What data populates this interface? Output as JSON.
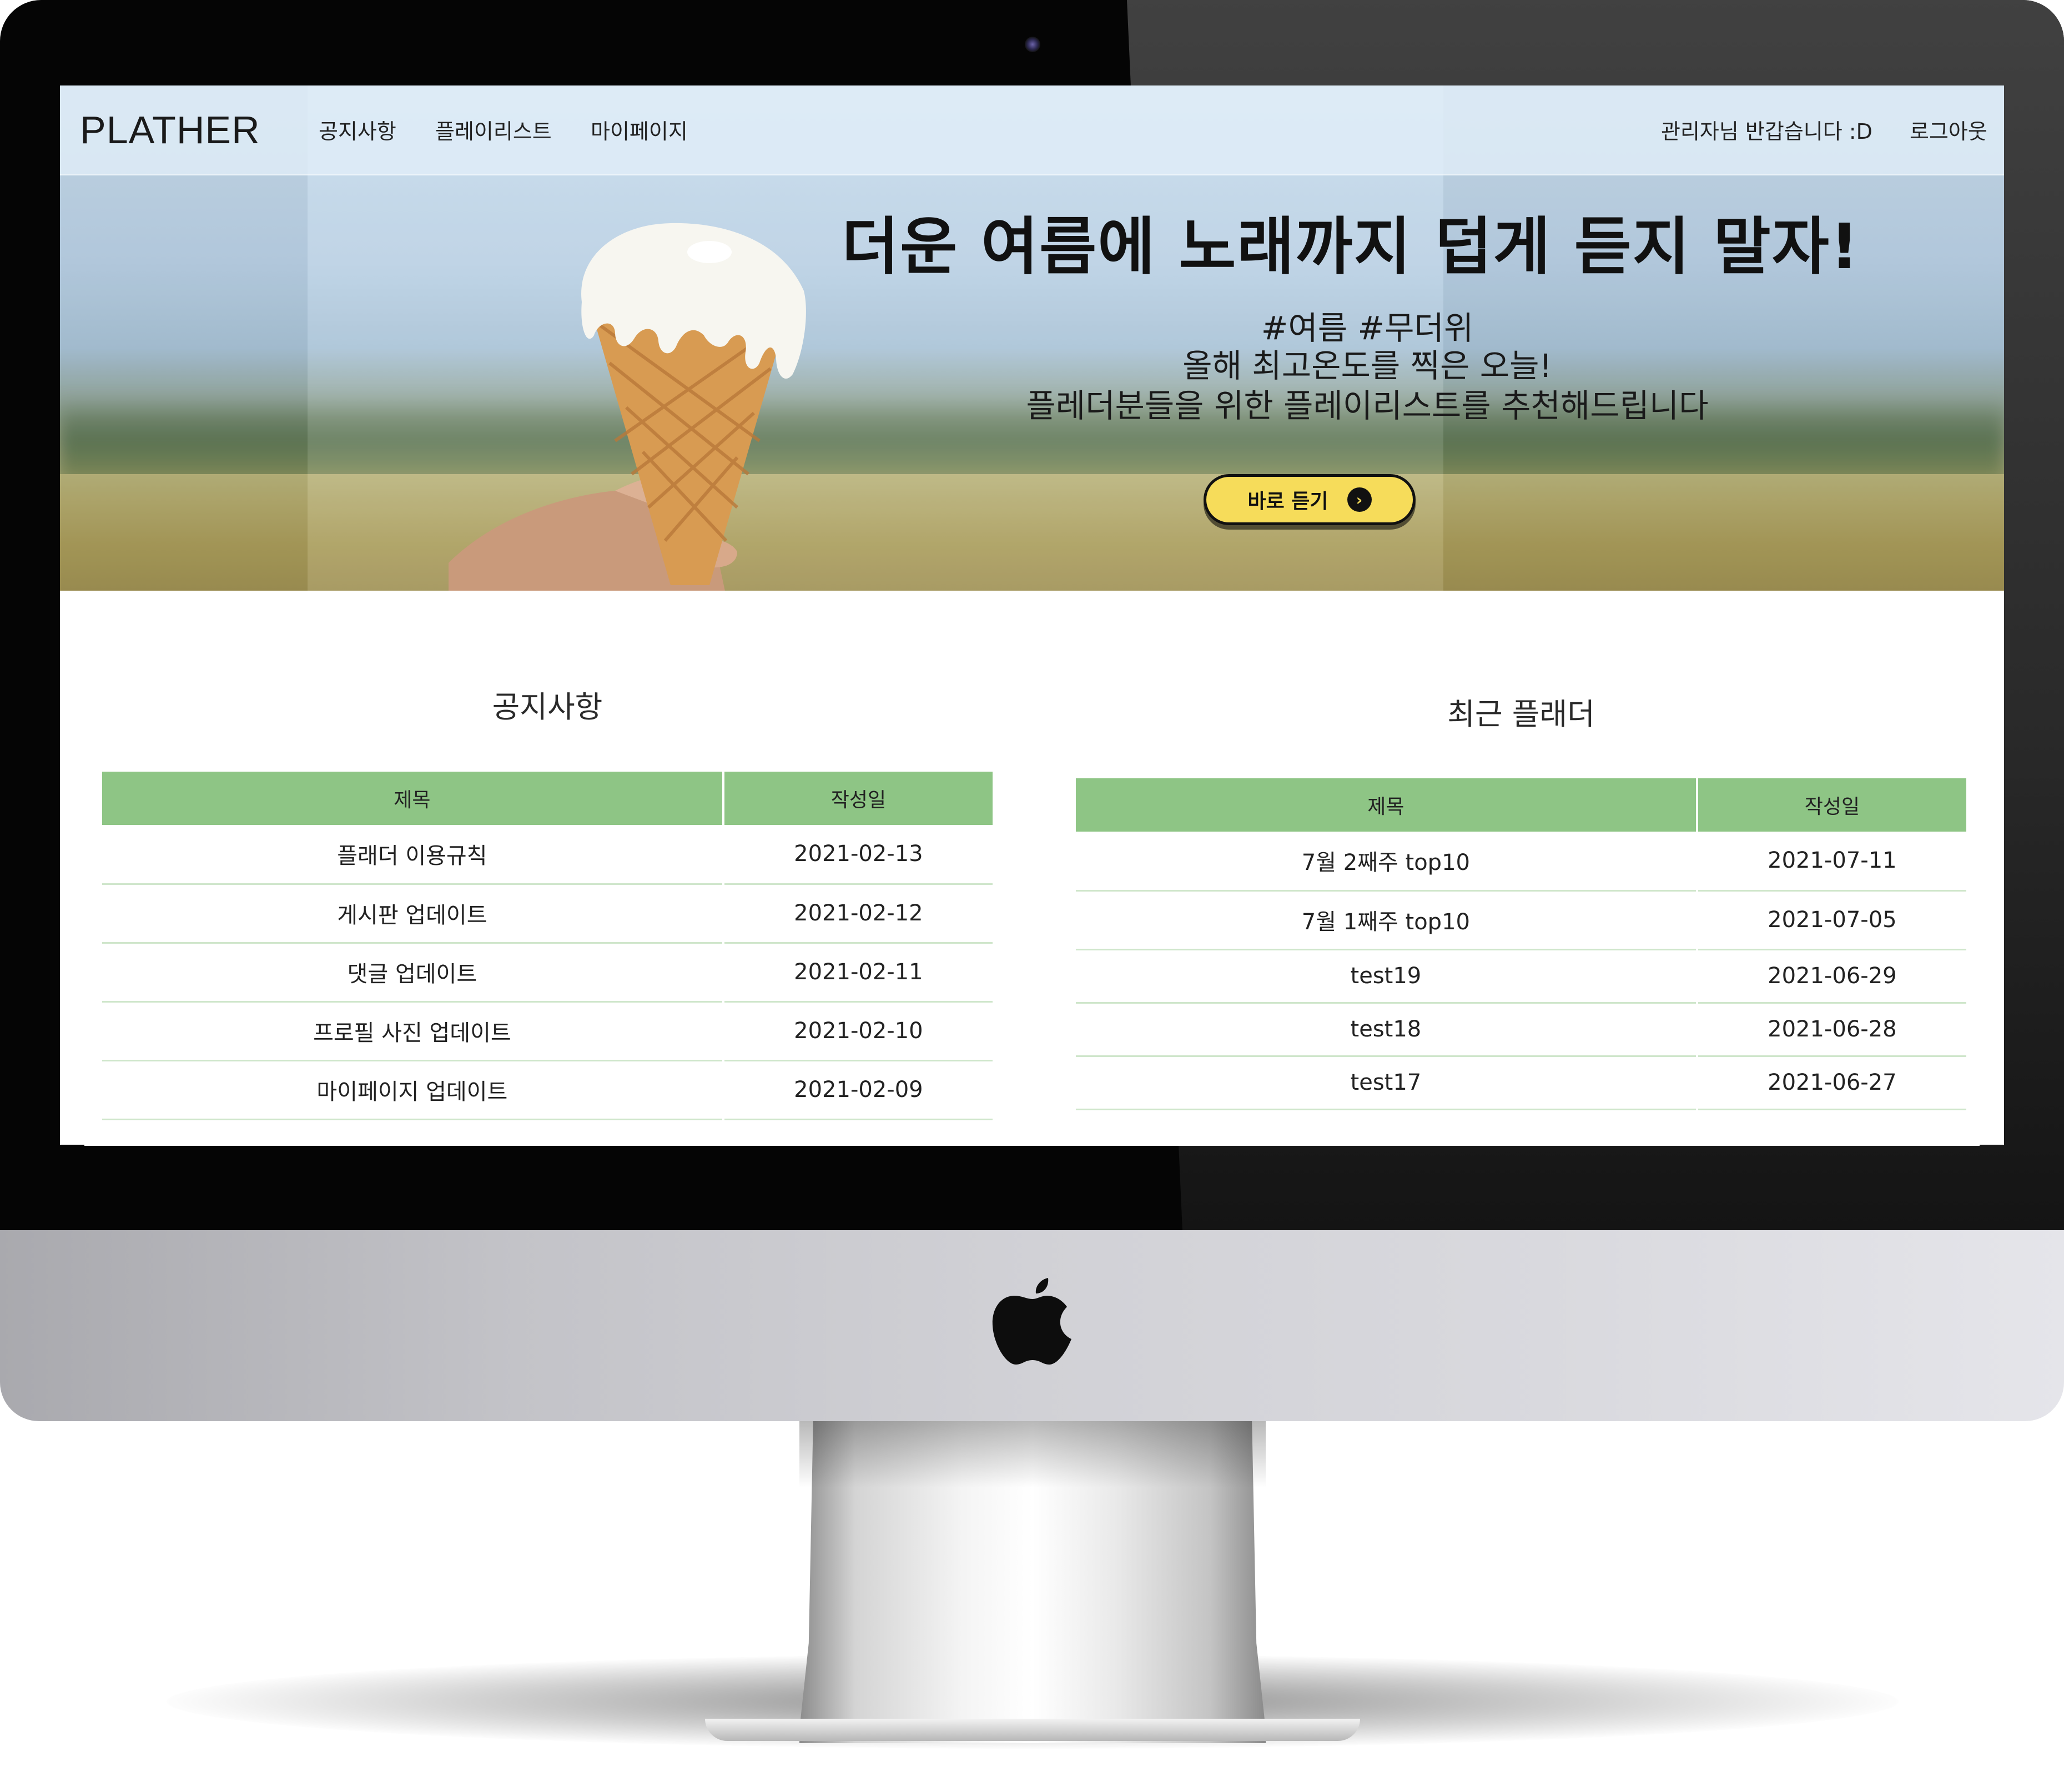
{
  "header": {
    "logo": "PLATHER",
    "menu": [
      "공지사항",
      "플레이리스트",
      "마이페이지"
    ],
    "greeting": "관리자님 반갑습니다 :D",
    "logout": "로그아웃"
  },
  "hero": {
    "heading": "더운 여름에 노래까지 덥게 듣지 말자!",
    "tags": "#여름 #무더위",
    "line1": "올해 최고온도를 찍은 오늘!",
    "line2": "플레더분들을 위한 플레이리스트를 추천해드립니다",
    "button_label": "바로 듣기",
    "button_icon": "arrow-right-circle-icon"
  },
  "notices": {
    "title": "공지사항",
    "columns": [
      "제목",
      "작성일"
    ],
    "rows": [
      {
        "title": "플래더 이용규칙",
        "date": "2021-02-13"
      },
      {
        "title": "게시판 업데이트",
        "date": "2021-02-12"
      },
      {
        "title": "댓글 업데이트",
        "date": "2021-02-11"
      },
      {
        "title": "프로필 사진 업데이트",
        "date": "2021-02-10"
      },
      {
        "title": "마이페이지 업데이트",
        "date": "2021-02-09"
      }
    ]
  },
  "recent": {
    "title": "최근 플래더",
    "columns": [
      "제목",
      "작성일"
    ],
    "rows": [
      {
        "title": "7월 2째주 top10",
        "date": "2021-07-11"
      },
      {
        "title": "7월 1째주 top10",
        "date": "2021-07-05"
      },
      {
        "title": "test19",
        "date": "2021-06-29"
      },
      {
        "title": "test18",
        "date": "2021-06-28"
      },
      {
        "title": "test17",
        "date": "2021-06-27"
      }
    ]
  },
  "colors": {
    "table_header": "#8ec585",
    "row_divider": "#cfe6cb",
    "button_fill": "#f6dc5a",
    "bezel": "#050505"
  }
}
